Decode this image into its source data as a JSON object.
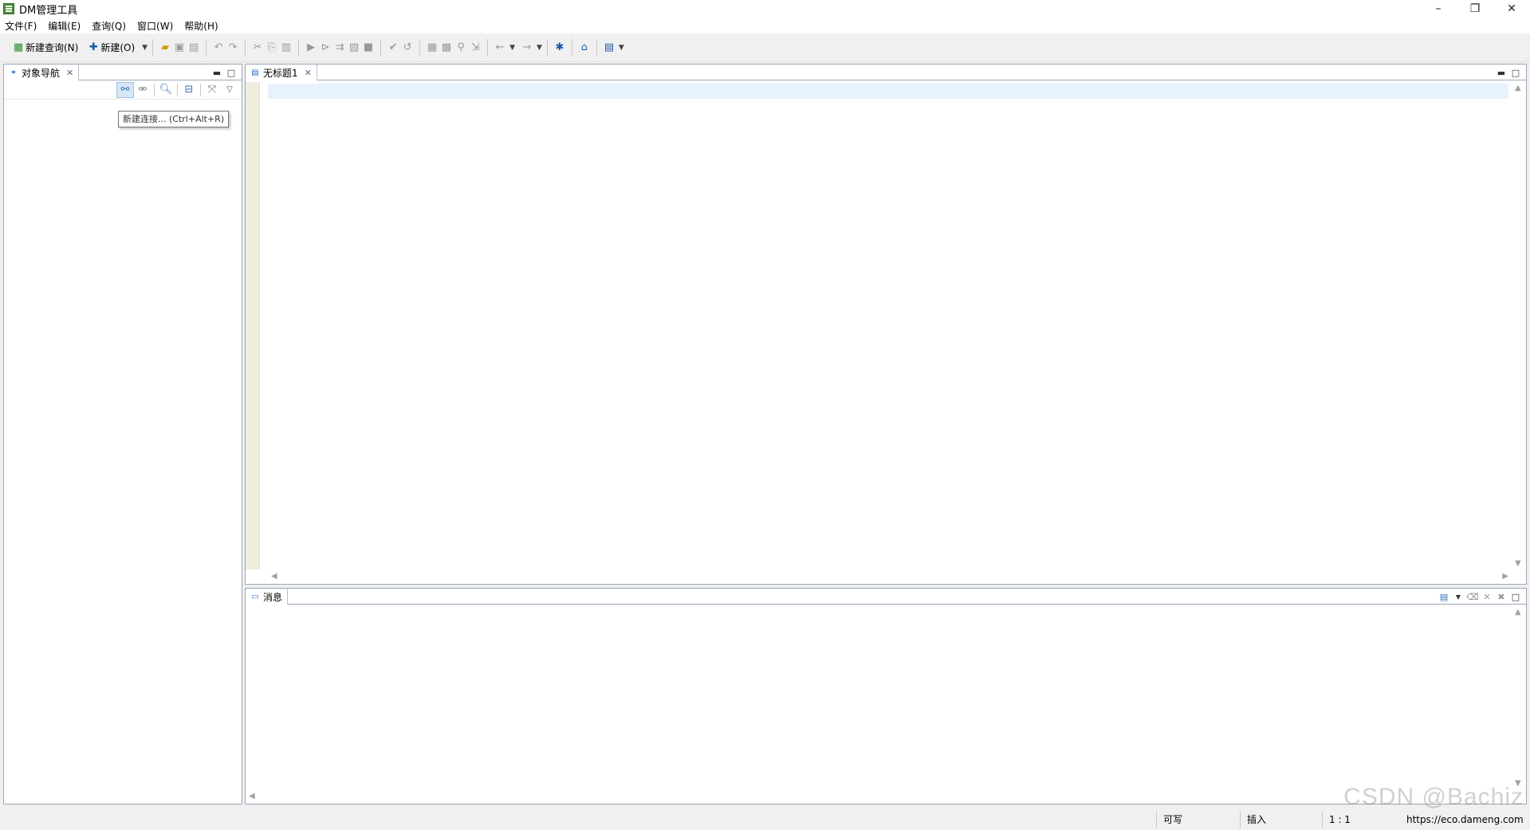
{
  "window": {
    "title": "DM管理工具",
    "minimize": "–",
    "maximize": "❐",
    "close": "✕"
  },
  "menu": [
    "文件(F)",
    "编辑(E)",
    "查询(Q)",
    "窗口(W)",
    "帮助(H)"
  ],
  "toolbar": {
    "new_query_label": "新建查询(N)",
    "new_label": "新建(O)"
  },
  "navigator": {
    "tab_label": "对象导航",
    "tooltip": "新建连接... (Ctrl+Alt+R)"
  },
  "editor": {
    "tab_label": "无标题1"
  },
  "messages": {
    "tab_label": "消息"
  },
  "status": {
    "writable": "可写",
    "mode": "插入",
    "position": "1 : 1",
    "url": "https://eco.dameng.com"
  },
  "watermark": "CSDN @Bachiz",
  "colors": {
    "accent": "#2d6cb4",
    "gutter": "#efeede",
    "current_line": "#e8f2fe"
  }
}
